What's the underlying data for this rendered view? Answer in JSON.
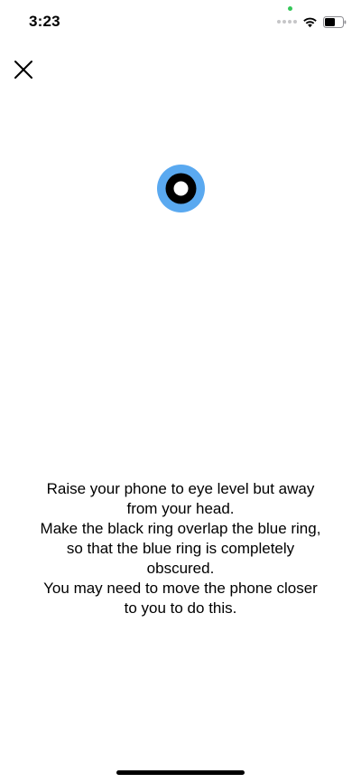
{
  "status_bar": {
    "time": "3:23",
    "icons": [
      "green-dot-icon",
      "signal-dots-icon",
      "wifi-icon",
      "battery-icon"
    ],
    "privacy_indicator_color": "#34c759"
  },
  "toolbar": {
    "close_icon": "close-icon"
  },
  "target": {
    "outer_color": "#5aa9f0",
    "ring_color": "#000000",
    "center_color": "#ffffff"
  },
  "instructions": {
    "line1": "Raise your phone to eye level but away from your head.",
    "line2": "Make the black ring overlap the blue ring, so that the blue ring is completely obscured.",
    "line3": "You may need to move the phone closer to you to do this."
  }
}
